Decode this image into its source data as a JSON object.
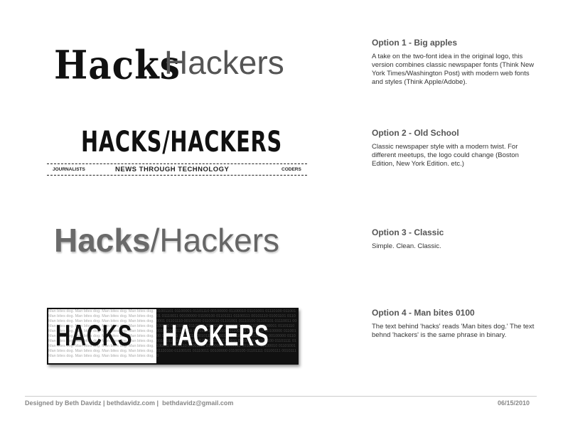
{
  "options": [
    {
      "title": "Option 1 - Big apples",
      "description": "A take on the two-font idea in the original logo, this version combines classic newspaper fonts (Think New York Times/Washington Post) with modern web fonts and styles (Think Apple/Adobe).",
      "logo": {
        "word1": "Hacks",
        "word2": "Hackers"
      }
    },
    {
      "title": "Option 2 - Old School",
      "description": "Classic newspaper style with a modern twist. For different meetups, the logo could change (Boston Edition, New York Edition. etc.)",
      "logo": {
        "main": "HACKS/HACKERS",
        "left_tag": "JOURNALISTS",
        "tagline": "NEWS THROUGH TECHNOLOGY",
        "right_tag": "CODERS"
      }
    },
    {
      "title": "Option 3 - Classic",
      "description": "Simple. Clean. Classic.",
      "logo": {
        "bold": "Hacks",
        "sep": "/",
        "thin": "Hackers"
      }
    },
    {
      "title": "Option 4 - Man bites 0100",
      "description": "The text behind 'hacks' reads 'Man bites dog.' The text behnd 'hackers' is the same phrase in binary.",
      "logo": {
        "word1": "HACKS",
        "word2": "HACKERS",
        "bg_text": "Man bites dog. Man bites dog. Man bites dog. Man bites dog. Man bites dog. Man bites dog. Man bites dog. Man bites dog. Man bites dog. Man bites dog. Man bites dog. Man bites dog. Man bites dog. Man bites dog. Man bites dog. Man bites dog. Man bites dog. Man bites dog. Man bites dog. Man bites dog. Man bites dog. Man bites dog. Man bites dog. Man bites dog. Man bites dog. Man bites dog. Man bites dog. Man bites dog. Man bites dog. Man bites dog. Man bites dog. Man bites dog. Man bites dog. Man bites dog. Man bites dog. Man bites dog. Man bites dog. Man bites dog. Man bites dog. Man bites dog.",
        "bg_binary": "01001101 01100001 01101110 00100000 01100010 01101001 01110100 01100101 01110011 00100000 01100100 01101111 01100111 00101110 01001101 01100001 01101110 00100000 01100010 01101001 01110100 01100101 01110011 00100000 01100100 01101111 01100111 00101110 01001101 01100001 01101110 00100000 01100010 01101001 01110100 01100101 01110011 00100000 01100100 01101111 01100111 00101110 01001101 01100001 01101110 00100000 01100010 01101001 01110100 01100101 01110011 00100000 01100100 01101111 01100111 00101110 01001101 01100001 01101110 00100000 01100010 01101001 01110100 01100101 01110011 00100000 01100100 01101111 01100111 00101110"
      }
    }
  ],
  "footer": {
    "credit": "Designed by Beth Davidz | bethdavidz.com |  bethdavidz@gmail.com",
    "date": "06/15/2010"
  }
}
